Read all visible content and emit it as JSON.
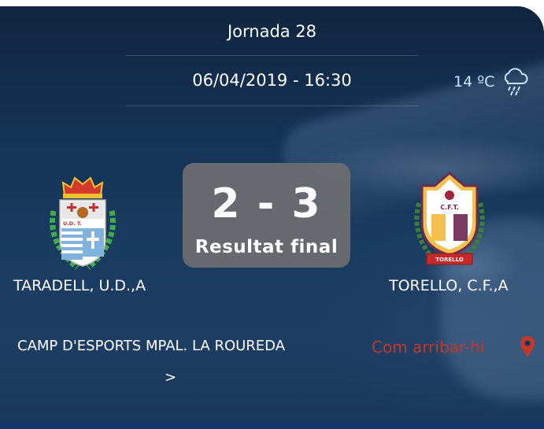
{
  "match": {
    "round": "Jornada 28",
    "datetime": "06/04/2019 - 16:30",
    "temperature": "14 ºC",
    "weather_icon": "rain-cloud-icon",
    "score": "2 - 3",
    "status": "Resultat final"
  },
  "home_team": {
    "name": "TARADELL, U.D.,A",
    "crest_text": "U.D.      T."
  },
  "away_team": {
    "name": "TORELLO, C.F.,A",
    "crest_text": "C.F.T.",
    "crest_banner": "TORELLO"
  },
  "venue": {
    "name": "CAMP D'ESPORTS MPAL. LA ROUREDA",
    "arrow": ">",
    "directions_label": "Com arribar-hi",
    "directions_icon": "map-pin-icon"
  },
  "colors": {
    "background": "#1a3759",
    "score_box": "#6e6e70",
    "directions": "#c0392b",
    "temperature": "#c9e4ff"
  }
}
